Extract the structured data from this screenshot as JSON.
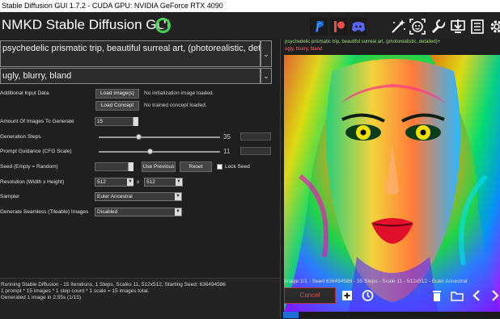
{
  "window": {
    "title": "Stable Diffusion GUI 1.7.2 - CUDA GPU: NVIDIA GeForce RTX 4090"
  },
  "header": {
    "app_title": "NMKD Stable Diffusion GUI",
    "icons": [
      "paypal-icon",
      "patreon-icon",
      "discord-icon",
      "magic-wand-icon",
      "face-icon",
      "wrench-icon",
      "install-icon",
      "log-icon",
      "gear-icon"
    ],
    "colors": {
      "paypal": "#1a6ad6",
      "patreon": "#f24d47",
      "discord": "#5865f2",
      "status_ring": "#43d14f"
    }
  },
  "prompt": {
    "positive": "psychedelic prismatic trip, beautiful surreal art, (photorealistic, detailed)+",
    "negative": "ugly, blurry, bland"
  },
  "form": {
    "additional_input_label": "Additional Input Data",
    "load_images_label": "Load Image(s)",
    "no_init_image": "No initialization image loaded.",
    "load_concept_label": "Load Concept",
    "no_concept": "No trained concept loaded.",
    "amount_label": "Amount Of Images To Generate",
    "amount_value": "15",
    "steps_label": "Generation Steps",
    "steps_value": "35",
    "steps_fraction": 0.33,
    "guidance_label": "Prompt Guidance (CFG Scale)",
    "guidance_value": "11",
    "guidance_fraction": 0.42,
    "seed_label": "Seed (Empty = Random)",
    "seed_value": "",
    "use_previous_label": "Use Previous",
    "reset_label": "Reset",
    "lock_seed_label": "Lock Seed",
    "resolution_label": "Resolution (Width x Height)",
    "width": "512",
    "x_sep": "x",
    "height": "512",
    "sampler_label": "Sampler",
    "sampler_value": "Euler Ancestral",
    "seamless_label": "Generate Seamless (Tileable) Images",
    "seamless_value": "Disabled"
  },
  "log": {
    "line1": "Running Stable Diffusion - 15 Iterations, 1 Steps, Scales 11, 512x512, Starting Seed: 636494586",
    "line2": "1 prompt * 15 images * 1 step count * 1 scale = 15 images total.",
    "line3": "Generated 1 image in 2.55s (1/15)"
  },
  "preview": {
    "prompt": "psychedelic prismatic trip, beautiful surreal art, (photorealistic, detailed)+",
    "negative": "ugly, blurry, bland",
    "status": "Image 1/1 - Seed 636494586 - 35 Steps - Scale 11 - 512x512 - Euler Ancestral",
    "cancel_label": "Cancel",
    "prompt_color": "#9ee27a",
    "negative_color": "#ff6a6a",
    "progress_fraction": 0.07
  }
}
